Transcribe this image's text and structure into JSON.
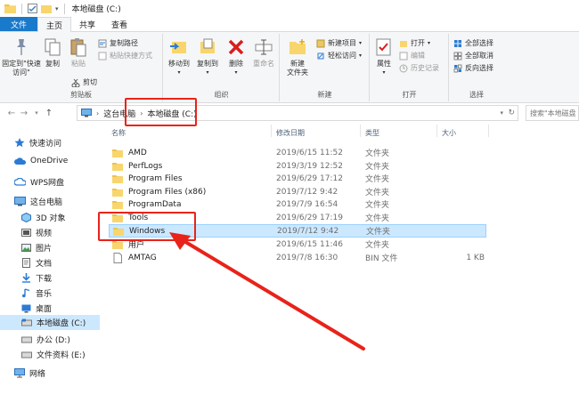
{
  "window": {
    "title": "本地磁盘 (C:)"
  },
  "tabs": [
    "文件",
    "主页",
    "共享",
    "查看"
  ],
  "ribbon": {
    "clipboard": {
      "pin": "固定到\"快速访问\"",
      "copy": "复制",
      "paste": "粘贴",
      "copy_path": "复制路径",
      "paste_shortcut": "粘贴快捷方式",
      "cut": "剪切",
      "label": "剪贴板"
    },
    "organize": {
      "move_to": "移动到",
      "copy_to": "复制到",
      "delete": "删除",
      "rename": "重命名",
      "label": "组织"
    },
    "new": {
      "new_folder": "新建\n文件夹",
      "new_item": "新建项目",
      "easy_access": "轻松访问",
      "label": "新建"
    },
    "open": {
      "properties": "属性",
      "open": "打开",
      "edit": "编辑",
      "history": "历史记录",
      "label": "打开"
    },
    "select": {
      "select_all": "全部选择",
      "select_none": "全部取消",
      "invert": "反向选择",
      "label": "选择"
    }
  },
  "address": {
    "crumbs": [
      "这台电脑",
      "本地磁盘 (C:)"
    ],
    "search_placeholder": "搜索\"本地磁盘 (C:)\""
  },
  "nav": {
    "items": [
      {
        "label": "快速访问",
        "icon": "star-icon"
      },
      {
        "label": "OneDrive",
        "icon": "cloud-icon"
      },
      {
        "label": "WPS网盘",
        "icon": "wps-cloud-icon"
      },
      {
        "label": "这台电脑",
        "icon": "computer-icon"
      },
      {
        "label": "3D 对象",
        "icon": "cube-icon"
      },
      {
        "label": "视频",
        "icon": "video-icon"
      },
      {
        "label": "图片",
        "icon": "picture-icon"
      },
      {
        "label": "文档",
        "icon": "document-icon"
      },
      {
        "label": "下载",
        "icon": "download-icon"
      },
      {
        "label": "音乐",
        "icon": "music-icon"
      },
      {
        "label": "桌面",
        "icon": "desktop-icon"
      },
      {
        "label": "本地磁盘 (C:)",
        "icon": "drive-icon"
      },
      {
        "label": "办公 (D:)",
        "icon": "drive-icon"
      },
      {
        "label": "文件资料 (E:)",
        "icon": "drive-icon"
      },
      {
        "label": "网络",
        "icon": "network-icon"
      }
    ]
  },
  "columns": {
    "name": "名称",
    "date": "修改日期",
    "type": "类型",
    "size": "大小"
  },
  "files": [
    {
      "name": "AMD",
      "date": "2019/6/15 11:52",
      "type": "文件夹",
      "size": ""
    },
    {
      "name": "PerfLogs",
      "date": "2019/3/19 12:52",
      "type": "文件夹",
      "size": ""
    },
    {
      "name": "Program Files",
      "date": "2019/6/29 17:12",
      "type": "文件夹",
      "size": ""
    },
    {
      "name": "Program Files (x86)",
      "date": "2019/7/12 9:42",
      "type": "文件夹",
      "size": ""
    },
    {
      "name": "ProgramData",
      "date": "2019/7/9 16:54",
      "type": "文件夹",
      "size": ""
    },
    {
      "name": "Tools",
      "date": "2019/6/29 17:19",
      "type": "文件夹",
      "size": ""
    },
    {
      "name": "Windows",
      "date": "2019/7/12 9:42",
      "type": "文件夹",
      "size": ""
    },
    {
      "name": "用户",
      "date": "2019/6/15 11:46",
      "type": "文件夹",
      "size": ""
    },
    {
      "name": "AMTAG",
      "date": "2019/7/8 16:30",
      "type": "BIN 文件",
      "size": "1 KB"
    }
  ],
  "colors": {
    "accent": "#1979ca",
    "selection": "#cce8ff",
    "annotation": "#e8231a",
    "folder": "#f8d66d"
  }
}
